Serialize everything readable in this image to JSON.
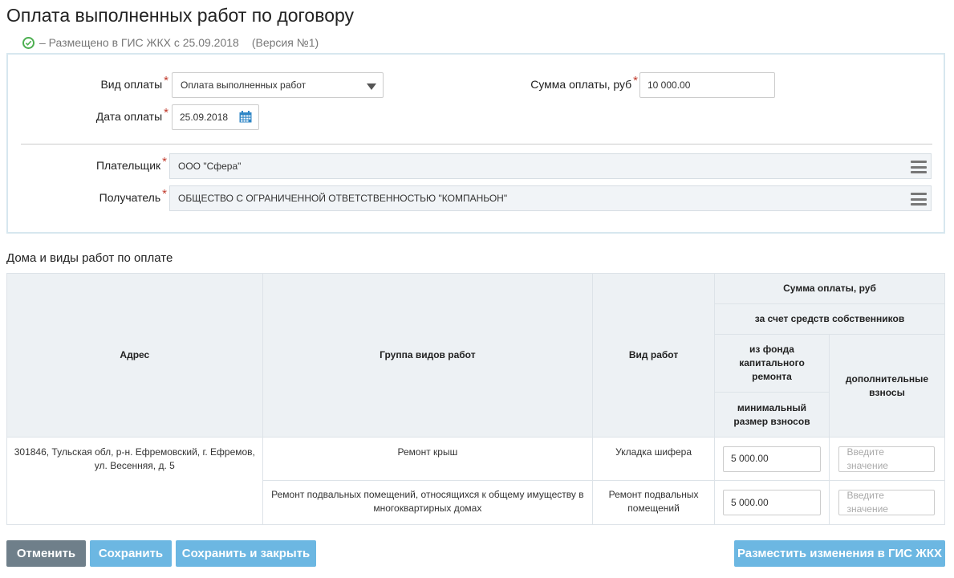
{
  "page": {
    "title": "Оплата выполненных работ по договору",
    "status_text": "–  Размещено в ГИС ЖКХ с 25.09.2018",
    "version_text": "(Версия №1)"
  },
  "form": {
    "payment_type": {
      "label": "Вид оплаты",
      "value": "Оплата выполненных работ"
    },
    "payment_sum": {
      "label": "Сумма оплаты, руб",
      "value": "10 000.00"
    },
    "payment_date": {
      "label": "Дата оплаты",
      "value": "25.09.2018"
    },
    "payer": {
      "label": "Плательщик",
      "value": "ООО \"Сфера\""
    },
    "recipient": {
      "label": "Получатель",
      "value": "ОБЩЕСТВО С ОГРАНИЧЕННОЙ ОТВЕТСТВЕННОСТЬЮ \"КОМПАНЬОН\""
    },
    "required_mark": "*"
  },
  "table": {
    "section_title": "Дома и виды работ по оплате",
    "headers": {
      "address": "Адрес",
      "work_group": "Группа видов работ",
      "work_type": "Вид работ",
      "sum": "Сумма оплаты, руб",
      "owners_funds": "за счет средств собственников",
      "capital_fund": "из фонда капитального ремонта",
      "min_contrib": "минимальный размер взносов",
      "additional": "дополнительные взносы"
    },
    "address": "301846, Тульская обл, р-н. Ефремовский, г. Ефремов, ул. Весенняя, д. 5",
    "rows": [
      {
        "work_group": "Ремонт крыш",
        "work_type": "Укладка шифера",
        "min_value": "5 000.00",
        "additional_placeholder": "Введите значение"
      },
      {
        "work_group": "Ремонт подвальных помещений, относящихся к общему имуществу в многоквартирных домах",
        "work_type": "Ремонт подвальных помещений",
        "min_value": "5 000.00",
        "additional_placeholder": "Введите значение"
      }
    ]
  },
  "buttons": {
    "cancel": "Отменить",
    "save": "Сохранить",
    "save_close": "Сохранить и закрыть",
    "publish": "Разместить изменения в ГИС ЖКХ"
  },
  "colors": {
    "accent": "#6cb7e2",
    "cancel": "#6f7f8a",
    "status_ok": "#4caf50",
    "required": "#c0392b"
  }
}
